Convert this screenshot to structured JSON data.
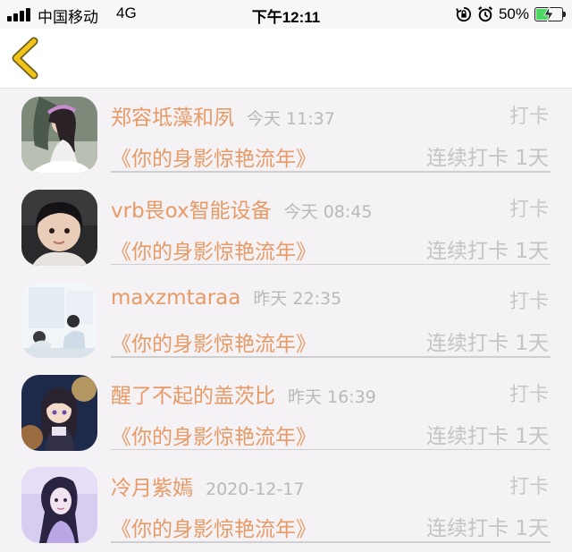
{
  "status_bar": {
    "carrier": "中国移动",
    "network": "4G",
    "time": "下午12:11",
    "battery_percent": "50%",
    "battery_level": 0.5
  },
  "nav": {
    "back_icon": "chevron-left-icon",
    "accent_color": "#f0c419"
  },
  "colors": {
    "name": "#e89a66",
    "muted": "#c4c4c4",
    "background": "#f4f2f4"
  },
  "records": [
    {
      "name": "郑容坻藻和夙",
      "time": "今天 11:37",
      "action": "打卡",
      "title": "《你的身影惊艳流年》",
      "streak": "连续打卡 1天",
      "avatar": "avatar-girl-white-dress"
    },
    {
      "name": "vrb畏ox智能设备",
      "time": "今天 08:45",
      "action": "打卡",
      "title": "《你的身影惊艳流年》",
      "streak": "连续打卡 1天",
      "avatar": "avatar-boy"
    },
    {
      "name": "maxzmtaraa",
      "time": "昨天 22:35",
      "action": "打卡",
      "title": "《你的身影惊艳流年》",
      "streak": "连续打卡 1天",
      "avatar": "avatar-illustration-couple"
    },
    {
      "name": "醒了不起的盖茨比",
      "time": "昨天 16:39",
      "action": "打卡",
      "title": "《你的身影惊艳流年》",
      "streak": "连续打卡 1天",
      "avatar": "avatar-anime-girl"
    },
    {
      "name": "冷月紫嫣",
      "time": "2020-12-17",
      "action": "打卡",
      "title": "《你的身影惊艳流年》",
      "streak": "连续打卡 1天",
      "avatar": "avatar-purple-girl"
    }
  ]
}
